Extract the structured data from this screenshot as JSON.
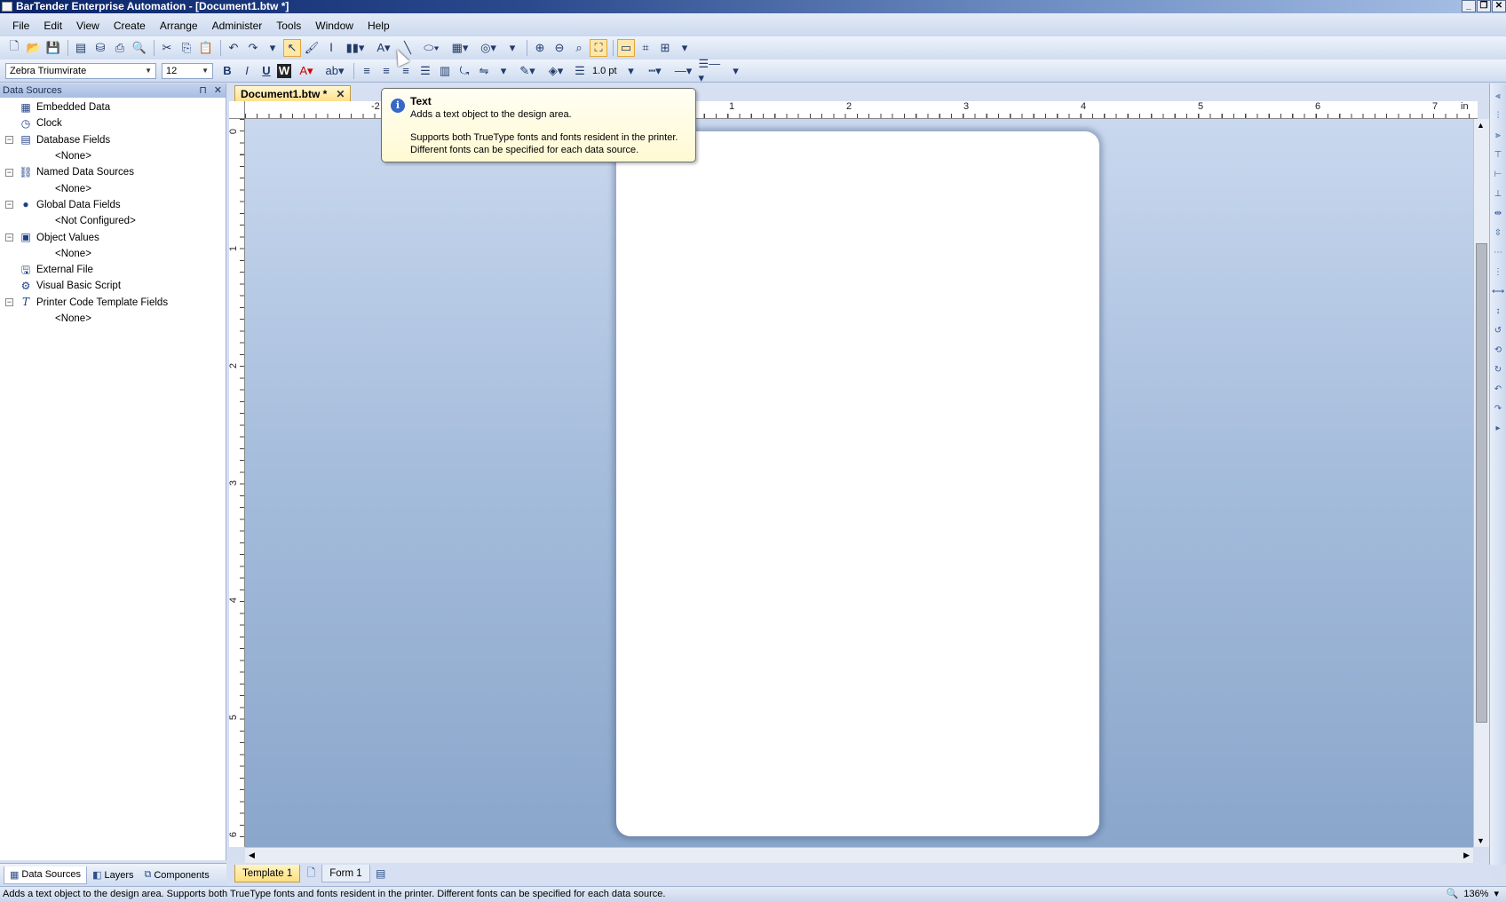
{
  "window": {
    "title": "BarTender Enterprise Automation - [Document1.btw *]",
    "buttons": [
      "_",
      "❐",
      "✕"
    ]
  },
  "menu": [
    "File",
    "Edit",
    "View",
    "Create",
    "Arrange",
    "Administer",
    "Tools",
    "Window",
    "Help"
  ],
  "format_toolbar": {
    "font_name": "Zebra Triumvirate",
    "font_size": "12",
    "bold": "B",
    "italic": "I",
    "underline": "U",
    "wordwrap": "W",
    "line_width": "1.0 pt"
  },
  "data_sources_panel": {
    "title": "Data Sources",
    "pin": "⊓",
    "close": "✕",
    "items": [
      {
        "label": "Embedded Data",
        "toggle": "",
        "child": ""
      },
      {
        "label": "Clock",
        "toggle": "",
        "child": ""
      },
      {
        "label": "Database Fields",
        "toggle": "−",
        "child": "<None>"
      },
      {
        "label": "Named Data Sources",
        "toggle": "−",
        "child": "<None>"
      },
      {
        "label": "Global Data Fields",
        "toggle": "−",
        "child": "<Not Configured>"
      },
      {
        "label": "Object Values",
        "toggle": "−",
        "child": "<None>"
      },
      {
        "label": "External File",
        "toggle": "",
        "child": ""
      },
      {
        "label": "Visual Basic Script",
        "toggle": "",
        "child": ""
      },
      {
        "label": "Printer Code Template Fields",
        "toggle": "−",
        "child": "<None>"
      }
    ],
    "tabs": [
      "Data Sources",
      "Layers",
      "Components"
    ]
  },
  "document_tab": {
    "label": "Document1.btw *",
    "close": "✕"
  },
  "ruler": {
    "horizontal_numbers": [
      "-2",
      "1",
      "2",
      "3",
      "4",
      "5",
      "6",
      "7",
      "in"
    ],
    "vertical_numbers": [
      "0",
      "1",
      "2",
      "3",
      "4",
      "5",
      "6"
    ]
  },
  "template_tabs": [
    "Template 1",
    "Form 1"
  ],
  "tooltip": {
    "title": "Text",
    "summary": "Adds a text object to the design area.",
    "detail_line1": "Supports both TrueType fonts and fonts resident in the printer.",
    "detail_line2": "Different fonts can be specified for each data source."
  },
  "statusbar": {
    "message": "Adds a text object to the design area. Supports both TrueType fonts and fonts resident in the printer. Different fonts can be specified for each data source.",
    "zoom": "136%"
  },
  "colors": {
    "title_bar": "#0a246a",
    "active_tab": "#ffe08a",
    "canvas_top": "#c9d8ee",
    "canvas_bottom": "#8aa6cb"
  }
}
